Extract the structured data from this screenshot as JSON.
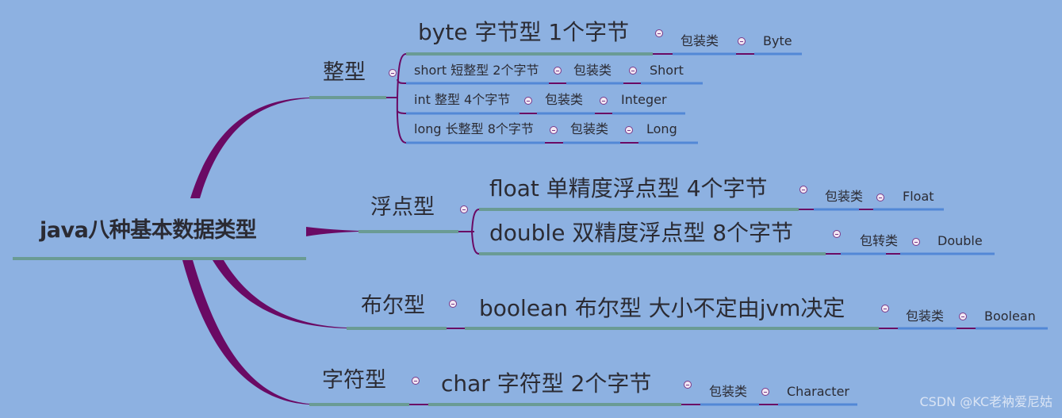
{
  "root": {
    "label": "java八种基本数据类型"
  },
  "categories": [
    {
      "label": "整型",
      "items": [
        {
          "label": "byte 字节型 1个字节",
          "wrapper_label": "包装类",
          "wrapper_class": "Byte"
        },
        {
          "label": "short 短整型 2个字节",
          "wrapper_label": "包装类",
          "wrapper_class": "Short"
        },
        {
          "label": "int 整型 4个字节",
          "wrapper_label": "包装类",
          "wrapper_class": "Integer"
        },
        {
          "label": "long 长整型 8个字节",
          "wrapper_label": "包装类",
          "wrapper_class": "Long"
        }
      ]
    },
    {
      "label": "浮点型",
      "items": [
        {
          "label": "float 单精度浮点型 4个字节",
          "wrapper_label": "包装类",
          "wrapper_class": "Float"
        },
        {
          "label": "double 双精度浮点型  8个字节",
          "wrapper_label": "包转类",
          "wrapper_class": "Double"
        }
      ]
    },
    {
      "label": "布尔型",
      "items": [
        {
          "label": "boolean 布尔型 大小不定由jvm决定",
          "wrapper_label": "包装类",
          "wrapper_class": "Boolean"
        }
      ]
    },
    {
      "label": "字符型",
      "items": [
        {
          "label": "char  字符型 2个字节",
          "wrapper_label": "包装类",
          "wrapper_class": "Character"
        }
      ]
    }
  ],
  "colors": {
    "background": "#8db1e1",
    "branch": "#6a0a64",
    "topic_underline": "#6a9b94",
    "leaf_underline": "#5288d6",
    "text": "#2b2b33"
  },
  "watermark": "CSDN @KC老衲爱尼姑"
}
